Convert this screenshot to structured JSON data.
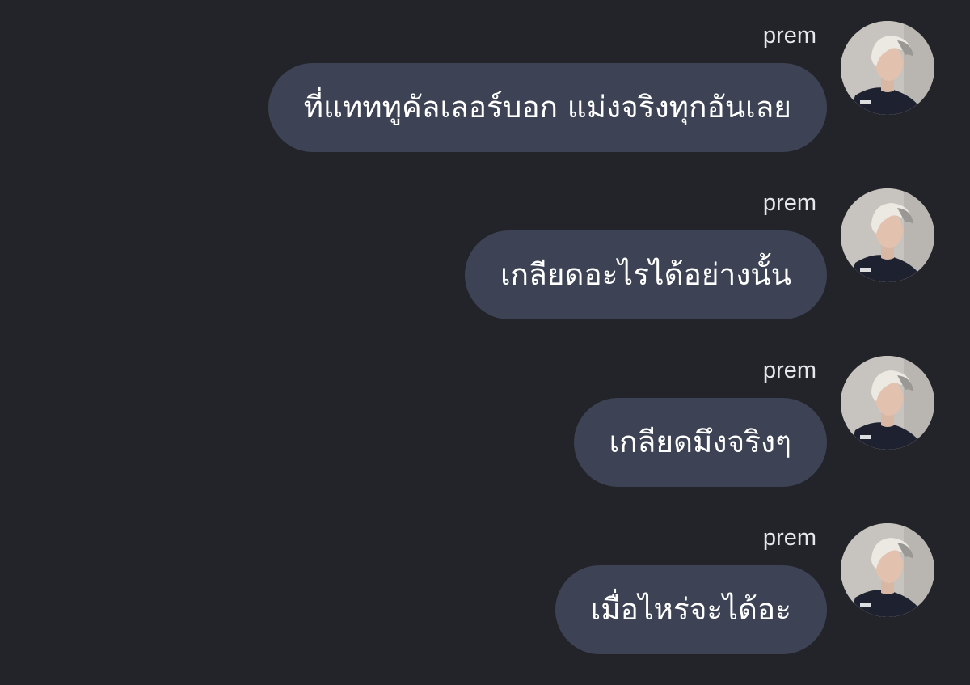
{
  "messages": [
    {
      "sender": "prem",
      "text": "ที่แทททูคัลเลอร์บอก แม่งจริงทุกอันเลย",
      "avatar_icon": "user-photo-avatar"
    },
    {
      "sender": "prem",
      "text": "เกลียดอะไรได้อย่างนั้น",
      "avatar_icon": "user-photo-avatar"
    },
    {
      "sender": "prem",
      "text": "เกลียดมึงจริงๆ",
      "avatar_icon": "user-photo-avatar"
    },
    {
      "sender": "prem",
      "text": "เมื่อไหร่จะได้อะ",
      "avatar_icon": "user-photo-avatar"
    }
  ],
  "colors": {
    "background": "#232429",
    "bubble": "#3d4354",
    "text": "#ffffff",
    "sender": "#e6e7ea"
  }
}
